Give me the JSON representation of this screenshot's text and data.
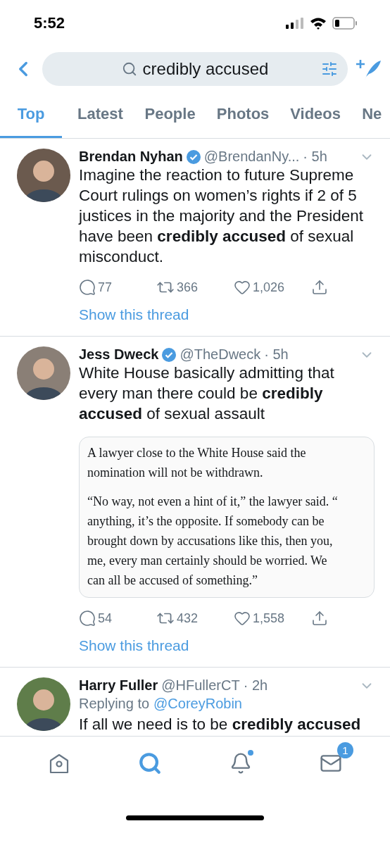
{
  "status_bar": {
    "time": "5:52"
  },
  "search": {
    "value": "credibly accused"
  },
  "tabs": [
    {
      "label": "Top",
      "selected": true
    },
    {
      "label": "Latest",
      "selected": false
    },
    {
      "label": "People",
      "selected": false
    },
    {
      "label": "Photos",
      "selected": false
    },
    {
      "label": "Videos",
      "selected": false
    },
    {
      "label": "Ne",
      "selected": false
    }
  ],
  "tweets": [
    {
      "name": "Brendan Nyhan",
      "verified": true,
      "handle": "@BrendanNy...",
      "time": "· 5h",
      "body": "Imagine the reaction to future Supreme Court rulings on women’s rights if 2 of 5 justices in the majority and the President have been **credibly accused** of sexual misconduct.",
      "stats": {
        "replies": "77",
        "retweets": "366",
        "likes": "1,026"
      },
      "show_thread": "Show this thread"
    },
    {
      "name": "Jess Dweck",
      "verified": true,
      "handle": "@TheDweck",
      "time": "· 5h",
      "body": "White House basically admitting that every man there could be **credibly accused** of sexual assault",
      "quote": {
        "paragraphs": [
          [
            "A lawyer close to the White House said the",
            "nomination will not be withdrawn."
          ],
          [
            "“No way, not even a hint of it,” the lawyer said. “",
            "anything, it’s the opposite. If somebody can be",
            "brought down by accusations like this, then you,",
            "me, every man certainly should be worried. We",
            "can all be accused of something.”"
          ]
        ]
      },
      "stats": {
        "replies": "54",
        "retweets": "432",
        "likes": "1,558"
      },
      "show_thread": "Show this thread"
    },
    {
      "name": "Harry Fuller",
      "verified": false,
      "handle": "@HFullerCT",
      "time": "· 2h",
      "replying_label": "Replying to",
      "replying_to": "@CoreyRobin",
      "body": "If all we need is to be **credibly accused**"
    }
  ],
  "bottom_nav": [
    {
      "kind": "home",
      "selected": false
    },
    {
      "kind": "search",
      "selected": true
    },
    {
      "kind": "notifications",
      "selected": false,
      "unread": true
    },
    {
      "kind": "messages",
      "selected": false,
      "badge": "1"
    }
  ]
}
